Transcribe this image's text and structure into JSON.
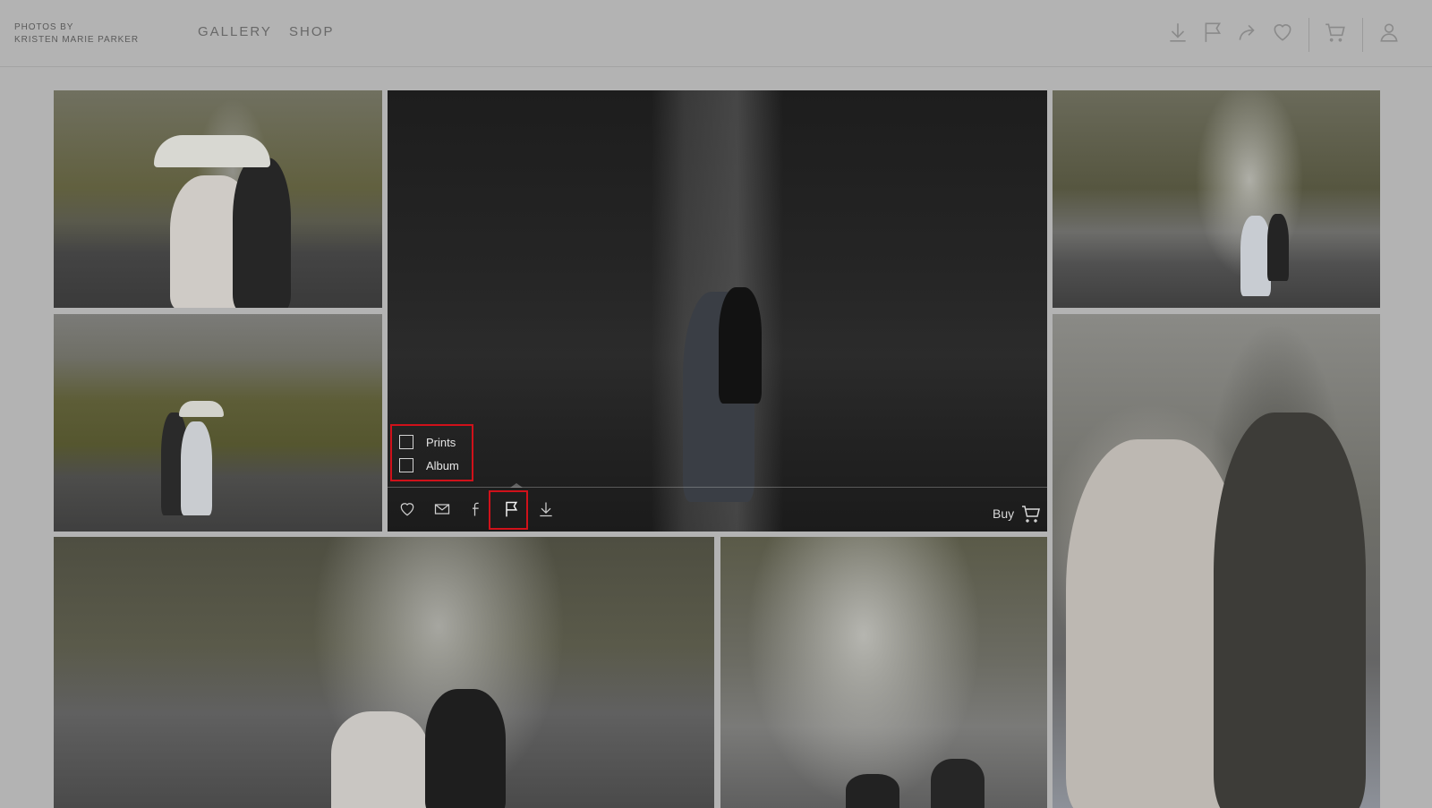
{
  "brand": {
    "line1": "PHOTOS BY",
    "line2": "KRISTEN MARIE PARKER"
  },
  "nav": [
    {
      "label": "GALLERY"
    },
    {
      "label": "SHOP"
    }
  ],
  "header_icons": [
    "download-icon",
    "flag-icon",
    "share-icon",
    "heart-icon",
    "cart-icon",
    "user-icon"
  ],
  "action_bar": {
    "icons": [
      "heart-icon",
      "mail-icon",
      "facebook-icon",
      "flag-icon",
      "download-icon"
    ],
    "buy_label": "Buy"
  },
  "flag_menu": {
    "options": [
      {
        "label": "Prints",
        "checked": false
      },
      {
        "label": "Album",
        "checked": false
      }
    ]
  },
  "colors": {
    "highlight": "#d0111a",
    "overlay_bg": "#b3b3b3"
  }
}
